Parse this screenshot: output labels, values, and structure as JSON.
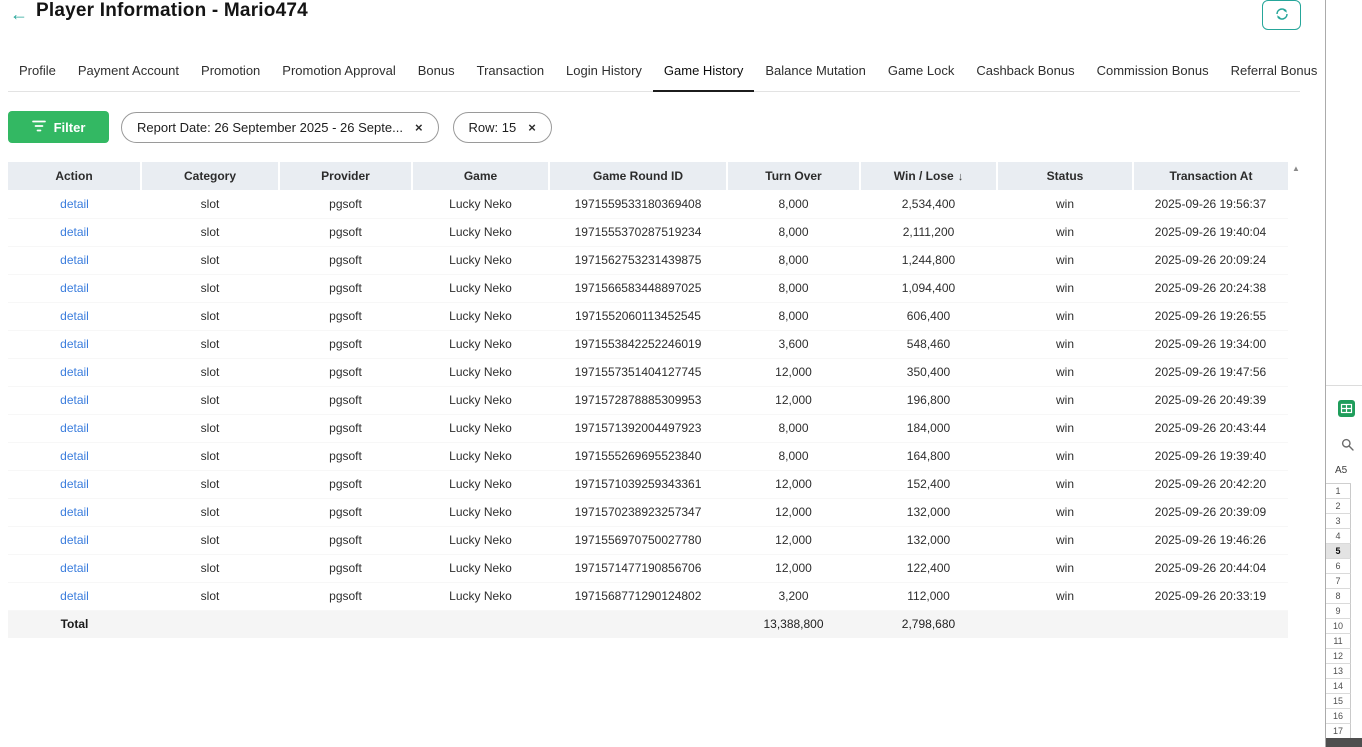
{
  "header": {
    "title": "Player Information - Mario474"
  },
  "icons": {
    "back": "←",
    "close": "×",
    "scroll_up": "▲"
  },
  "tabs": [
    {
      "label": "Profile",
      "active": false
    },
    {
      "label": "Payment Account",
      "active": false
    },
    {
      "label": "Promotion",
      "active": false
    },
    {
      "label": "Promotion Approval",
      "active": false
    },
    {
      "label": "Bonus",
      "active": false
    },
    {
      "label": "Transaction",
      "active": false
    },
    {
      "label": "Login History",
      "active": false
    },
    {
      "label": "Game History",
      "active": true
    },
    {
      "label": "Balance Mutation",
      "active": false
    },
    {
      "label": "Game Lock",
      "active": false
    },
    {
      "label": "Cashback Bonus",
      "active": false
    },
    {
      "label": "Commission Bonus",
      "active": false
    },
    {
      "label": "Referral Bonus",
      "active": false
    }
  ],
  "filter": {
    "button_label": "Filter",
    "chips": [
      {
        "label": "Report Date: 26 September 2025 - 26 Septe..."
      },
      {
        "label": "Row: 15"
      }
    ]
  },
  "table": {
    "columns": [
      "Action",
      "Category",
      "Provider",
      "Game",
      "Game Round ID",
      "Turn Over",
      "Win / Lose",
      "Status",
      "Transaction At"
    ],
    "row_keys": [
      "action",
      "category",
      "provider",
      "game",
      "round_id",
      "turn_over",
      "win_lose",
      "status",
      "transaction_at"
    ],
    "sort": {
      "column": "Win / Lose",
      "icon": "↓"
    },
    "rows": [
      {
        "action": "detail",
        "category": "slot",
        "provider": "pgsoft",
        "game": "Lucky Neko",
        "round_id": "1971559533180369408",
        "turn_over": "8,000",
        "win_lose": "2,534,400",
        "status": "win",
        "transaction_at": "2025-09-26 19:56:37"
      },
      {
        "action": "detail",
        "category": "slot",
        "provider": "pgsoft",
        "game": "Lucky Neko",
        "round_id": "1971555370287519234",
        "turn_over": "8,000",
        "win_lose": "2,111,200",
        "status": "win",
        "transaction_at": "2025-09-26 19:40:04"
      },
      {
        "action": "detail",
        "category": "slot",
        "provider": "pgsoft",
        "game": "Lucky Neko",
        "round_id": "1971562753231439875",
        "turn_over": "8,000",
        "win_lose": "1,244,800",
        "status": "win",
        "transaction_at": "2025-09-26 20:09:24"
      },
      {
        "action": "detail",
        "category": "slot",
        "provider": "pgsoft",
        "game": "Lucky Neko",
        "round_id": "1971566583448897025",
        "turn_over": "8,000",
        "win_lose": "1,094,400",
        "status": "win",
        "transaction_at": "2025-09-26 20:24:38"
      },
      {
        "action": "detail",
        "category": "slot",
        "provider": "pgsoft",
        "game": "Lucky Neko",
        "round_id": "1971552060113452545",
        "turn_over": "8,000",
        "win_lose": "606,400",
        "status": "win",
        "transaction_at": "2025-09-26 19:26:55"
      },
      {
        "action": "detail",
        "category": "slot",
        "provider": "pgsoft",
        "game": "Lucky Neko",
        "round_id": "1971553842252246019",
        "turn_over": "3,600",
        "win_lose": "548,460",
        "status": "win",
        "transaction_at": "2025-09-26 19:34:00"
      },
      {
        "action": "detail",
        "category": "slot",
        "provider": "pgsoft",
        "game": "Lucky Neko",
        "round_id": "1971557351404127745",
        "turn_over": "12,000",
        "win_lose": "350,400",
        "status": "win",
        "transaction_at": "2025-09-26 19:47:56"
      },
      {
        "action": "detail",
        "category": "slot",
        "provider": "pgsoft",
        "game": "Lucky Neko",
        "round_id": "1971572878885309953",
        "turn_over": "12,000",
        "win_lose": "196,800",
        "status": "win",
        "transaction_at": "2025-09-26 20:49:39"
      },
      {
        "action": "detail",
        "category": "slot",
        "provider": "pgsoft",
        "game": "Lucky Neko",
        "round_id": "1971571392004497923",
        "turn_over": "8,000",
        "win_lose": "184,000",
        "status": "win",
        "transaction_at": "2025-09-26 20:43:44"
      },
      {
        "action": "detail",
        "category": "slot",
        "provider": "pgsoft",
        "game": "Lucky Neko",
        "round_id": "1971555269695523840",
        "turn_over": "8,000",
        "win_lose": "164,800",
        "status": "win",
        "transaction_at": "2025-09-26 19:39:40"
      },
      {
        "action": "detail",
        "category": "slot",
        "provider": "pgsoft",
        "game": "Lucky Neko",
        "round_id": "1971571039259343361",
        "turn_over": "12,000",
        "win_lose": "152,400",
        "status": "win",
        "transaction_at": "2025-09-26 20:42:20"
      },
      {
        "action": "detail",
        "category": "slot",
        "provider": "pgsoft",
        "game": "Lucky Neko",
        "round_id": "1971570238923257347",
        "turn_over": "12,000",
        "win_lose": "132,000",
        "status": "win",
        "transaction_at": "2025-09-26 20:39:09"
      },
      {
        "action": "detail",
        "category": "slot",
        "provider": "pgsoft",
        "game": "Lucky Neko",
        "round_id": "1971556970750027780",
        "turn_over": "12,000",
        "win_lose": "132,000",
        "status": "win",
        "transaction_at": "2025-09-26 19:46:26"
      },
      {
        "action": "detail",
        "category": "slot",
        "provider": "pgsoft",
        "game": "Lucky Neko",
        "round_id": "1971571477190856706",
        "turn_over": "12,000",
        "win_lose": "122,400",
        "status": "win",
        "transaction_at": "2025-09-26 20:44:04"
      },
      {
        "action": "detail",
        "category": "slot",
        "provider": "pgsoft",
        "game": "Lucky Neko",
        "round_id": "1971568771290124802",
        "turn_over": "3,200",
        "win_lose": "112,000",
        "status": "win",
        "transaction_at": "2025-09-26 20:33:19"
      }
    ],
    "total": {
      "label": "Total",
      "turn_over": "13,388,800",
      "win_lose": "2,798,680"
    }
  },
  "side_panel": {
    "cell_ref": "A5",
    "selected_row": "5",
    "row_numbers": [
      "1",
      "2",
      "3",
      "4",
      "5",
      "6",
      "7",
      "8",
      "9",
      "10",
      "11",
      "12",
      "13",
      "14",
      "15",
      "16",
      "17"
    ]
  },
  "colors": {
    "accent_teal": "#26a69a",
    "filter_green": "#33b863",
    "link_blue": "#3b7ddd",
    "table_header_bg": "#e9edf2"
  }
}
